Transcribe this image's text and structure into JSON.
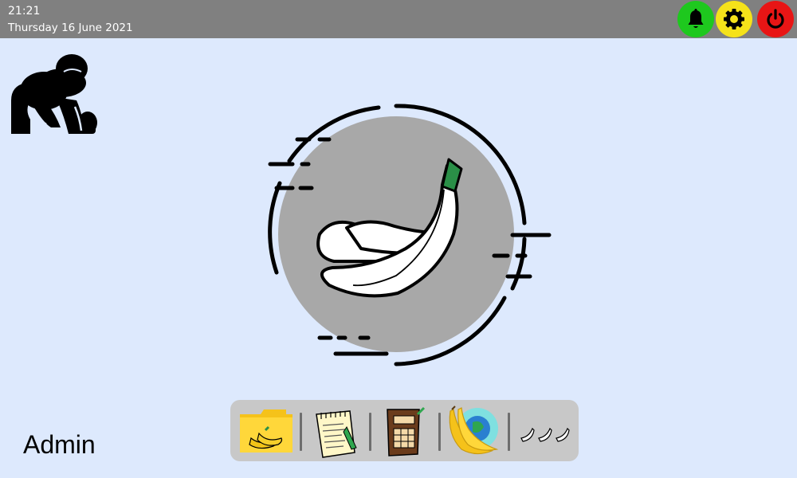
{
  "status_bar": {
    "time": "21:21",
    "date": "Thursday 16 June 2021",
    "buttons": [
      {
        "icon": "bell-icon",
        "color": "#1ec81e"
      },
      {
        "icon": "gear-icon",
        "color": "#f5e21a"
      },
      {
        "icon": "power-icon",
        "color": "#e81515"
      }
    ]
  },
  "desktop": {
    "logo_icon": "gorilla-icon",
    "hero_icon": "banana-icon",
    "user_label": "Admin"
  },
  "dock": {
    "items": [
      {
        "icon": "banana-folder-icon"
      },
      {
        "icon": "notepad-icon"
      },
      {
        "icon": "calculator-icon"
      },
      {
        "icon": "banana-browser-icon"
      },
      {
        "icon": "more-bananas-icon"
      }
    ]
  },
  "colors": {
    "background": "#dde9fd",
    "status_bar": "#808080",
    "dock": "#c8c8c8",
    "hero_circle": "#a8a8a8"
  }
}
